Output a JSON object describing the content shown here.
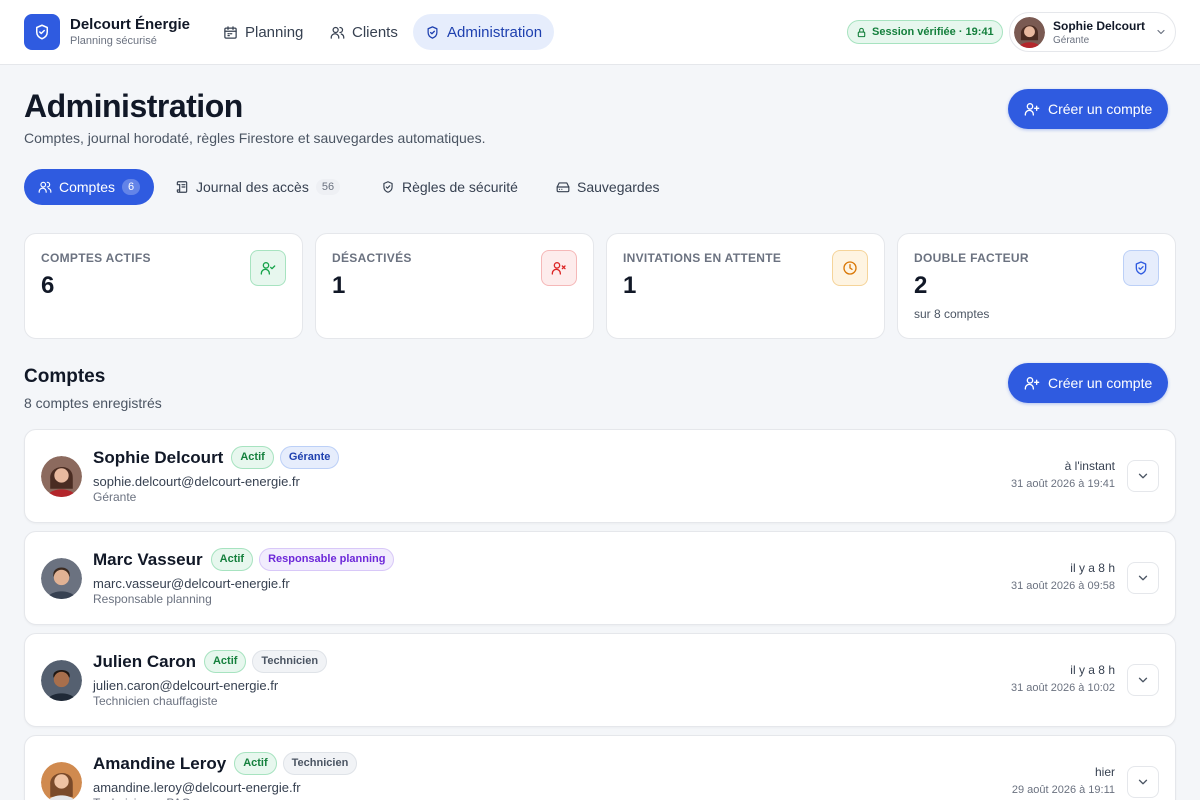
{
  "brand": {
    "name": "Delcourt Énergie",
    "subtitle": "Planning sécurisé"
  },
  "nav": [
    {
      "label": "Planning",
      "icon": "calendar-icon"
    },
    {
      "label": "Clients",
      "icon": "users-icon"
    },
    {
      "label": "Administration",
      "icon": "shield-icon",
      "active": true
    }
  ],
  "session": {
    "label": "Session vérifiée · 19:41"
  },
  "user": {
    "name": "Sophie Delcourt",
    "role": "Gérante"
  },
  "page": {
    "title": "Administration",
    "subtitle": "Comptes, journal horodaté, règles Firestore et sauvegardes automatiques.",
    "create_label": "Créer un compte"
  },
  "tabs": [
    {
      "label": "Comptes",
      "count": "6",
      "icon": "users-icon",
      "active": true
    },
    {
      "label": "Journal des accès",
      "count": "56",
      "icon": "scroll-icon"
    },
    {
      "label": "Règles de sécurité",
      "count": "",
      "icon": "shield-icon"
    },
    {
      "label": "Sauvegardes",
      "count": "",
      "icon": "hard-drive-icon"
    }
  ],
  "stats": [
    {
      "label": "Comptes actifs",
      "value": "6",
      "note": "",
      "icon": "user-check-icon",
      "color": "#16a34a"
    },
    {
      "label": "Désactivés",
      "value": "1",
      "note": "",
      "icon": "user-x-icon",
      "color": "#dc2626"
    },
    {
      "label": "Invitations en attente",
      "value": "1",
      "note": "",
      "icon": "clock-icon",
      "color": "#d97706"
    },
    {
      "label": "Double facteur",
      "value": "2",
      "note": "sur 8 comptes",
      "icon": "shield-check-icon",
      "color": "#2f5be0"
    }
  ],
  "section": {
    "title": "Comptes",
    "subtitle": "8 comptes enregistrés",
    "create_label": "Créer un compte"
  },
  "accounts": [
    {
      "name": "Sophie Delcourt",
      "status": "Actif",
      "role_badge": "Gérante",
      "email": "sophie.delcourt@delcourt-energie.fr",
      "role": "Gérante",
      "last_seen": "à l'instant",
      "date": "31 août 2026 à 19:41"
    },
    {
      "name": "Marc Vasseur",
      "status": "Actif",
      "role_badge": "Responsable planning",
      "email": "marc.vasseur@delcourt-energie.fr",
      "role": "Responsable planning",
      "last_seen": "il y a 8 h",
      "date": "31 août 2026 à 09:58"
    },
    {
      "name": "Julien Caron",
      "status": "Actif",
      "role_badge": "Technicien",
      "email": "julien.caron@delcourt-energie.fr",
      "role": "Technicien chauffagiste",
      "last_seen": "il y a 8 h",
      "date": "31 août 2026 à 10:02"
    },
    {
      "name": "Amandine Leroy",
      "status": "Actif",
      "role_badge": "Technicien",
      "email": "amandine.leroy@delcourt-energie.fr",
      "role": "Technicienne PAC",
      "last_seen": "hier",
      "date": "29 août 2026 à 19:11"
    }
  ],
  "colors": {
    "accent": "#2f5be0",
    "success": "#16a34a",
    "danger": "#dc2626",
    "warning": "#d97706"
  }
}
